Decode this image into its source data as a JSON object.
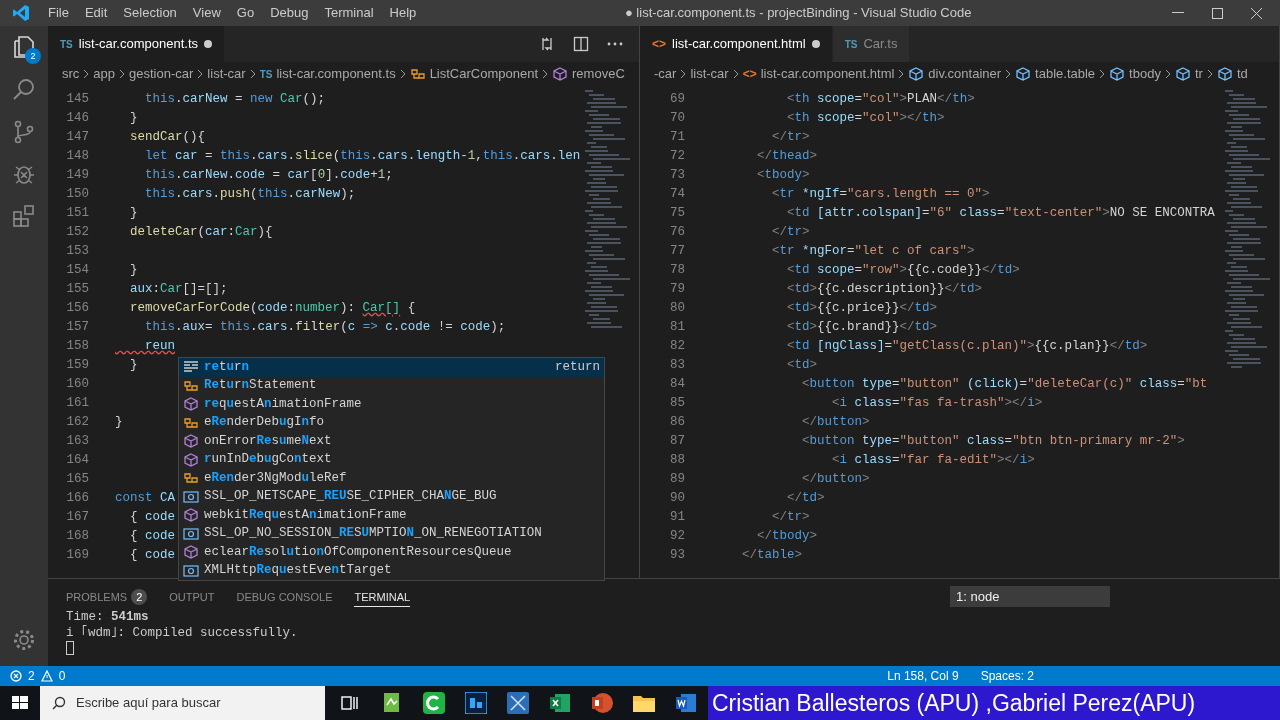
{
  "window": {
    "title": "● list-car.component.ts - projectBinding - Visual Studio Code"
  },
  "menu": [
    "File",
    "Edit",
    "Selection",
    "View",
    "Go",
    "Debug",
    "Terminal",
    "Help"
  ],
  "activity_bar": {
    "explorer_badge": "2"
  },
  "editor_groups": [
    {
      "tabs": [
        {
          "icon": "TS",
          "label": "list-car.component.ts",
          "selected": true,
          "modified": true
        }
      ],
      "breadcrumbs": [
        {
          "kind": "text",
          "label": "src"
        },
        {
          "kind": "text",
          "label": "app"
        },
        {
          "kind": "text",
          "label": "gestion-car"
        },
        {
          "kind": "text",
          "label": "list-car"
        },
        {
          "kind": "file",
          "icon": "TS",
          "label": "list-car.component.ts"
        },
        {
          "kind": "class",
          "label": "ListCarComponent"
        },
        {
          "kind": "method",
          "label": "removeC"
        }
      ],
      "lines": [
        {
          "number": "145",
          "segments": [
            {
              "text": "    this",
              "kind": "k"
            },
            {
              "text": ".",
              "kind": "p"
            },
            {
              "text": "carNew",
              "kind": "v"
            },
            {
              "text": " = ",
              "kind": "p"
            },
            {
              "text": "new",
              "kind": "k"
            },
            {
              "text": " Car",
              "kind": "t"
            },
            {
              "text": "();",
              "kind": "p"
            }
          ]
        },
        {
          "number": "146",
          "segments": [
            {
              "text": "  }",
              "kind": "p"
            }
          ]
        },
        {
          "number": "147",
          "segments": [
            {
              "text": "  sendCar",
              "kind": "f"
            },
            {
              "text": "(){",
              "kind": "p"
            }
          ]
        },
        {
          "number": "148",
          "segments": [
            {
              "text": "    let",
              "kind": "k"
            },
            {
              "text": " car",
              "kind": "v"
            },
            {
              "text": " = ",
              "kind": "p"
            },
            {
              "text": "this",
              "kind": "k"
            },
            {
              "text": ".",
              "kind": "p"
            },
            {
              "text": "cars",
              "kind": "v"
            },
            {
              "text": ".",
              "kind": "p"
            },
            {
              "text": "slice",
              "kind": "f"
            },
            {
              "text": "(",
              "kind": "p"
            },
            {
              "text": "this",
              "kind": "k"
            },
            {
              "text": ".",
              "kind": "p"
            },
            {
              "text": "cars",
              "kind": "v"
            },
            {
              "text": ".",
              "kind": "p"
            },
            {
              "text": "length",
              "kind": "v"
            },
            {
              "text": "-",
              "kind": "p"
            },
            {
              "text": "1",
              "kind": "n"
            },
            {
              "text": ",",
              "kind": "p"
            },
            {
              "text": "this",
              "kind": "k"
            },
            {
              "text": ".",
              "kind": "p"
            },
            {
              "text": "cars",
              "kind": "v"
            },
            {
              "text": ".",
              "kind": "p"
            },
            {
              "text": "len",
              "kind": "v"
            }
          ]
        },
        {
          "number": "149",
          "segments": [
            {
              "text": "    this",
              "kind": "k"
            },
            {
              "text": ".",
              "kind": "p"
            },
            {
              "text": "carNew",
              "kind": "v"
            },
            {
              "text": ".",
              "kind": "p"
            },
            {
              "text": "code",
              "kind": "v"
            },
            {
              "text": " = ",
              "kind": "p"
            },
            {
              "text": "car",
              "kind": "v"
            },
            {
              "text": "[",
              "kind": "p"
            },
            {
              "text": "0",
              "kind": "n"
            },
            {
              "text": "].",
              "kind": "p"
            },
            {
              "text": "code",
              "kind": "v"
            },
            {
              "text": "+",
              "kind": "p"
            },
            {
              "text": "1",
              "kind": "n"
            },
            {
              "text": ";",
              "kind": "p"
            }
          ]
        },
        {
          "number": "150",
          "segments": [
            {
              "text": "    this",
              "kind": "k"
            },
            {
              "text": ".",
              "kind": "p"
            },
            {
              "text": "cars",
              "kind": "v"
            },
            {
              "text": ".",
              "kind": "p"
            },
            {
              "text": "push",
              "kind": "f"
            },
            {
              "text": "(",
              "kind": "p"
            },
            {
              "text": "this",
              "kind": "k"
            },
            {
              "text": ".",
              "kind": "p"
            },
            {
              "text": "carNew",
              "kind": "v"
            },
            {
              "text": ");",
              "kind": "p"
            }
          ]
        },
        {
          "number": "151",
          "segments": [
            {
              "text": "  }",
              "kind": "p"
            }
          ]
        },
        {
          "number": "152",
          "segments": [
            {
              "text": "  deleteCar",
              "kind": "f"
            },
            {
              "text": "(",
              "kind": "p"
            },
            {
              "text": "car",
              "kind": "v"
            },
            {
              "text": ":",
              "kind": "p"
            },
            {
              "text": "Car",
              "kind": "t"
            },
            {
              "text": "){",
              "kind": "p"
            }
          ]
        },
        {
          "number": "153"
        },
        {
          "number": "154",
          "segments": [
            {
              "text": "  }",
              "kind": "p"
            }
          ]
        },
        {
          "number": "155",
          "segments": [
            {
              "text": "  aux",
              "kind": "v"
            },
            {
              "text": ":",
              "kind": "p"
            },
            {
              "text": "Car",
              "kind": "t"
            },
            {
              "text": "[]=[];",
              "kind": "p"
            }
          ]
        },
        {
          "number": "156",
          "segments": [
            {
              "text": "  removeCarForCode",
              "kind": "f"
            },
            {
              "text": "(",
              "kind": "p"
            },
            {
              "text": "code",
              "kind": "v"
            },
            {
              "text": ":",
              "kind": "p"
            },
            {
              "text": "number",
              "kind": "t"
            },
            {
              "text": "): ",
              "kind": "p"
            },
            {
              "text": "Car[]",
              "kind": "terr"
            },
            {
              "text": " {",
              "kind": "p"
            }
          ]
        },
        {
          "number": "157",
          "segments": [
            {
              "text": "    this",
              "kind": "k"
            },
            {
              "text": ".",
              "kind": "p"
            },
            {
              "text": "aux",
              "kind": "v"
            },
            {
              "text": "= ",
              "kind": "p"
            },
            {
              "text": "this",
              "kind": "k"
            },
            {
              "text": ".",
              "kind": "p"
            },
            {
              "text": "cars",
              "kind": "v"
            },
            {
              "text": ".",
              "kind": "p"
            },
            {
              "text": "filter",
              "kind": "f"
            },
            {
              "text": "(",
              "kind": "p"
            },
            {
              "text": "c",
              "kind": "v"
            },
            {
              "text": " =>",
              "kind": "k"
            },
            {
              "text": " c",
              "kind": "v"
            },
            {
              "text": ".",
              "kind": "p"
            },
            {
              "text": "code",
              "kind": "v"
            },
            {
              "text": " != ",
              "kind": "p"
            },
            {
              "text": "code",
              "kind": "v"
            },
            {
              "text": ");",
              "kind": "p"
            }
          ]
        },
        {
          "number": "158",
          "segments": [
            {
              "text": "    reun",
              "kind": "verr"
            }
          ]
        },
        {
          "number": "159",
          "segments": [
            {
              "text": "  }",
              "kind": "p"
            }
          ]
        },
        {
          "number": "160"
        },
        {
          "number": "161"
        },
        {
          "number": "162",
          "segments": [
            {
              "text": "}",
              "kind": "p"
            }
          ]
        },
        {
          "number": "163"
        },
        {
          "number": "164"
        },
        {
          "number": "165"
        },
        {
          "number": "166",
          "segments": [
            {
              "text": "const",
              "kind": "k"
            },
            {
              "text": " CA",
              "kind": "v"
            }
          ]
        },
        {
          "number": "167",
          "segments": [
            {
              "text": "  { ",
              "kind": "p"
            },
            {
              "text": "code",
              "kind": "v"
            }
          ]
        },
        {
          "number": "168",
          "segments": [
            {
              "text": "  { ",
              "kind": "p"
            },
            {
              "text": "code",
              "kind": "v"
            }
          ]
        },
        {
          "number": "169",
          "segments": [
            {
              "text": "  { ",
              "kind": "p"
            },
            {
              "text": "code",
              "kind": "v"
            }
          ]
        }
      ],
      "suggestions": [
        {
          "kind": "keyword",
          "label": "**re**t**u**r**n**",
          "detail": "return",
          "selected": true
        },
        {
          "kind": "interface",
          "label": "**Re**t**u**r**n**Statement",
          "selected": false
        },
        {
          "kind": "method",
          "label": "**re**q**u**estA**n**imationFrame",
          "selected": false
        },
        {
          "kind": "interface",
          "label": "e**Re**nderDeb**u**gI**n**fo",
          "selected": false
        },
        {
          "kind": "method",
          "label": "onError**Re**s**u**me**N**ext",
          "selected": false
        },
        {
          "kind": "method",
          "label": "**r**unInD**e**b**u**gCo**n**text",
          "selected": false
        },
        {
          "kind": "interface",
          "label": "e**Ren**der3NgMod**u**leRef",
          "selected": false
        },
        {
          "kind": "variable",
          "label": "SSL_OP_NETSCAPE_**REU**SE_CIPHER_CHA**N**GE_BUG",
          "selected": false
        },
        {
          "kind": "method",
          "label": "webkit**Re**q**u**estA**n**imationFrame",
          "selected": false
        },
        {
          "kind": "variable",
          "label": "SSL_OP_NO_SESSION_**RE**S**U**MPTIO**N**_ON_RENEGOTIATION",
          "selected": false
        },
        {
          "kind": "method",
          "label": "eclear**Re**sol**u**tio**n**OfComponentResourcesQueue",
          "selected": false
        },
        {
          "kind": "variable",
          "label": "XMLHttp**Re**q**u**estEve**n**tTarget",
          "selected": false
        }
      ]
    },
    {
      "tabs": [
        {
          "icon": "<>",
          "label": "list-car.component.html",
          "selected": true,
          "modified": true
        },
        {
          "icon": "TS",
          "label": "Car.ts",
          "selected": false,
          "modified": false
        }
      ],
      "breadcrumbs": [
        {
          "kind": "text",
          "label": "-car"
        },
        {
          "kind": "text",
          "label": "list-car"
        },
        {
          "kind": "file",
          "icon": "<>",
          "label": "list-car.component.html"
        },
        {
          "kind": "element",
          "label": "div.container"
        },
        {
          "kind": "element",
          "label": "table.table"
        },
        {
          "kind": "element",
          "label": "tbody"
        },
        {
          "kind": "element",
          "label": "tr"
        },
        {
          "kind": "element",
          "label": "td"
        }
      ],
      "lines": [
        {
          "number": "69",
          "segments": [
            {
              "text": "          <",
              "kind": "g"
            },
            {
              "text": "th",
              "kind": "k"
            },
            {
              "text": " scope",
              "kind": "v"
            },
            {
              "text": "=",
              "kind": "p"
            },
            {
              "text": "\"col\"",
              "kind": "s"
            },
            {
              "text": ">",
              "kind": "g"
            },
            {
              "text": "PLAN",
              "kind": "p"
            },
            {
              "text": "</",
              "kind": "g"
            },
            {
              "text": "th",
              "kind": "k"
            },
            {
              "text": ">",
              "kind": "g"
            }
          ]
        },
        {
          "number": "70",
          "segments": [
            {
              "text": "          <",
              "kind": "g"
            },
            {
              "text": "th",
              "kind": "k"
            },
            {
              "text": " scope",
              "kind": "v"
            },
            {
              "text": "=",
              "kind": "p"
            },
            {
              "text": "\"col\"",
              "kind": "s"
            },
            {
              "text": "></",
              "kind": "g"
            },
            {
              "text": "th",
              "kind": "k"
            },
            {
              "text": ">",
              "kind": "g"
            }
          ]
        },
        {
          "number": "71",
          "segments": [
            {
              "text": "        </",
              "kind": "g"
            },
            {
              "text": "tr",
              "kind": "k"
            },
            {
              "text": ">",
              "kind": "g"
            }
          ]
        },
        {
          "number": "72",
          "segments": [
            {
              "text": "      </",
              "kind": "g"
            },
            {
              "text": "thead",
              "kind": "k"
            },
            {
              "text": ">",
              "kind": "g"
            }
          ]
        },
        {
          "number": "73",
          "segments": [
            {
              "text": "      <",
              "kind": "g"
            },
            {
              "text": "tbody",
              "kind": "k"
            },
            {
              "text": ">",
              "kind": "g"
            }
          ]
        },
        {
          "number": "74",
          "segments": [
            {
              "text": "        <",
              "kind": "g"
            },
            {
              "text": "tr",
              "kind": "k"
            },
            {
              "text": " *ngIf",
              "kind": "v"
            },
            {
              "text": "=",
              "kind": "p"
            },
            {
              "text": "\"cars.length == 0\"",
              "kind": "s"
            },
            {
              "text": ">",
              "kind": "g"
            }
          ]
        },
        {
          "number": "75",
          "segments": [
            {
              "text": "          <",
              "kind": "g"
            },
            {
              "text": "td",
              "kind": "k"
            },
            {
              "text": " [attr.colspan]",
              "kind": "v"
            },
            {
              "text": "=",
              "kind": "p"
            },
            {
              "text": "\"6\"",
              "kind": "s"
            },
            {
              "text": " class",
              "kind": "v"
            },
            {
              "text": "=",
              "kind": "p"
            },
            {
              "text": "\"text-center\"",
              "kind": "s"
            },
            {
              "text": ">",
              "kind": "g"
            },
            {
              "text": "NO SE ENCONTRA",
              "kind": "p"
            }
          ]
        },
        {
          "number": "76",
          "segments": [
            {
              "text": "        </",
              "kind": "g"
            },
            {
              "text": "tr",
              "kind": "k"
            },
            {
              "text": ">",
              "kind": "g"
            }
          ]
        },
        {
          "number": "77",
          "segments": [
            {
              "text": "        <",
              "kind": "g"
            },
            {
              "text": "tr",
              "kind": "k"
            },
            {
              "text": " *ngFor",
              "kind": "v"
            },
            {
              "text": "=",
              "kind": "p"
            },
            {
              "text": "\"let c of cars\"",
              "kind": "s"
            },
            {
              "text": ">",
              "kind": "g"
            }
          ]
        },
        {
          "number": "78",
          "segments": [
            {
              "text": "          <",
              "kind": "g"
            },
            {
              "text": "td",
              "kind": "k"
            },
            {
              "text": " scope",
              "kind": "v"
            },
            {
              "text": "=",
              "kind": "p"
            },
            {
              "text": "\"row\"",
              "kind": "s"
            },
            {
              "text": ">",
              "kind": "g"
            },
            {
              "text": "{{c.code}}",
              "kind": "p"
            },
            {
              "text": "</",
              "kind": "g"
            },
            {
              "text": "td",
              "kind": "k"
            },
            {
              "text": ">",
              "kind": "g"
            }
          ]
        },
        {
          "number": "79",
          "segments": [
            {
              "text": "          <",
              "kind": "g"
            },
            {
              "text": "td",
              "kind": "k"
            },
            {
              "text": ">",
              "kind": "g"
            },
            {
              "text": "{{c.description}}",
              "kind": "p"
            },
            {
              "text": "</",
              "kind": "g"
            },
            {
              "text": "td",
              "kind": "k"
            },
            {
              "text": ">",
              "kind": "g"
            }
          ]
        },
        {
          "number": "80",
          "segments": [
            {
              "text": "          <",
              "kind": "g"
            },
            {
              "text": "td",
              "kind": "k"
            },
            {
              "text": ">",
              "kind": "g"
            },
            {
              "text": "{{c.price}}",
              "kind": "p"
            },
            {
              "text": "</",
              "kind": "g"
            },
            {
              "text": "td",
              "kind": "k"
            },
            {
              "text": ">",
              "kind": "g"
            }
          ]
        },
        {
          "number": "81",
          "segments": [
            {
              "text": "          <",
              "kind": "g"
            },
            {
              "text": "td",
              "kind": "k"
            },
            {
              "text": ">",
              "kind": "g"
            },
            {
              "text": "{{c.brand}}",
              "kind": "p"
            },
            {
              "text": "</",
              "kind": "g"
            },
            {
              "text": "td",
              "kind": "k"
            },
            {
              "text": ">",
              "kind": "g"
            }
          ]
        },
        {
          "number": "82",
          "segments": [
            {
              "text": "          <",
              "kind": "g"
            },
            {
              "text": "td",
              "kind": "k"
            },
            {
              "text": " [ngClass]",
              "kind": "v"
            },
            {
              "text": "=",
              "kind": "p"
            },
            {
              "text": "\"getClass(c.plan)\"",
              "kind": "s"
            },
            {
              "text": ">",
              "kind": "g"
            },
            {
              "text": "{{c.plan}}",
              "kind": "p"
            },
            {
              "text": "</",
              "kind": "g"
            },
            {
              "text": "td",
              "kind": "k"
            },
            {
              "text": ">",
              "kind": "g"
            }
          ]
        },
        {
          "number": "83",
          "segments": [
            {
              "text": "          <",
              "kind": "g"
            },
            {
              "text": "td",
              "kind": "k"
            },
            {
              "text": ">",
              "kind": "g"
            }
          ]
        },
        {
          "number": "84",
          "segments": [
            {
              "text": "            <",
              "kind": "g"
            },
            {
              "text": "button",
              "kind": "k"
            },
            {
              "text": " type",
              "kind": "v"
            },
            {
              "text": "=",
              "kind": "p"
            },
            {
              "text": "\"button\"",
              "kind": "s"
            },
            {
              "text": " (click)",
              "kind": "v"
            },
            {
              "text": "=",
              "kind": "p"
            },
            {
              "text": "\"deleteCar(c)\"",
              "kind": "s"
            },
            {
              "text": " class",
              "kind": "v"
            },
            {
              "text": "=",
              "kind": "p"
            },
            {
              "text": "\"bt",
              "kind": "s"
            }
          ]
        },
        {
          "number": "85",
          "segments": [
            {
              "text": "                <",
              "kind": "g"
            },
            {
              "text": "i",
              "kind": "k"
            },
            {
              "text": " class",
              "kind": "v"
            },
            {
              "text": "=",
              "kind": "p"
            },
            {
              "text": "\"fas fa-trash\"",
              "kind": "s"
            },
            {
              "text": "></",
              "kind": "g"
            },
            {
              "text": "i",
              "kind": "k"
            },
            {
              "text": ">",
              "kind": "g"
            }
          ]
        },
        {
          "number": "86",
          "segments": [
            {
              "text": "            </",
              "kind": "g"
            },
            {
              "text": "button",
              "kind": "k"
            },
            {
              "text": ">",
              "kind": "g"
            }
          ]
        },
        {
          "number": "87",
          "segments": [
            {
              "text": "            <",
              "kind": "g"
            },
            {
              "text": "button",
              "kind": "k"
            },
            {
              "text": " type",
              "kind": "v"
            },
            {
              "text": "=",
              "kind": "p"
            },
            {
              "text": "\"button\"",
              "kind": "s"
            },
            {
              "text": " class",
              "kind": "v"
            },
            {
              "text": "=",
              "kind": "p"
            },
            {
              "text": "\"btn btn-primary mr-2\"",
              "kind": "s"
            },
            {
              "text": ">",
              "kind": "g"
            }
          ]
        },
        {
          "number": "88",
          "segments": [
            {
              "text": "                <",
              "kind": "g"
            },
            {
              "text": "i",
              "kind": "k"
            },
            {
              "text": " class",
              "kind": "v"
            },
            {
              "text": "=",
              "kind": "p"
            },
            {
              "text": "\"far fa-edit\"",
              "kind": "s"
            },
            {
              "text": "></",
              "kind": "g"
            },
            {
              "text": "i",
              "kind": "k"
            },
            {
              "text": ">",
              "kind": "g"
            }
          ]
        },
        {
          "number": "89",
          "segments": [
            {
              "text": "            </",
              "kind": "g"
            },
            {
              "text": "button",
              "kind": "k"
            },
            {
              "text": ">",
              "kind": "g"
            }
          ]
        },
        {
          "number": "90",
          "segments": [
            {
              "text": "          </",
              "kind": "g"
            },
            {
              "text": "td",
              "kind": "k"
            },
            {
              "text": ">",
              "kind": "g"
            }
          ]
        },
        {
          "number": "91",
          "segments": [
            {
              "text": "        </",
              "kind": "g"
            },
            {
              "text": "tr",
              "kind": "k"
            },
            {
              "text": ">",
              "kind": "g"
            }
          ]
        },
        {
          "number": "92",
          "segments": [
            {
              "text": "      </",
              "kind": "g"
            },
            {
              "text": "tbody",
              "kind": "k"
            },
            {
              "text": ">",
              "kind": "g"
            }
          ]
        },
        {
          "number": "93",
          "segments": [
            {
              "text": "    </",
              "kind": "g"
            },
            {
              "text": "table",
              "kind": "k"
            },
            {
              "text": ">",
              "kind": "g"
            }
          ]
        }
      ]
    }
  ],
  "panel": {
    "tabs": [
      {
        "label": "PROBLEMS",
        "badge": "2",
        "selected": false
      },
      {
        "label": "OUTPUT",
        "selected": false
      },
      {
        "label": "DEBUG CONSOLE",
        "selected": false
      },
      {
        "label": "TERMINAL",
        "selected": true
      }
    ],
    "terminal_select": "1: node",
    "terminal_lines": [
      "Time: **541ms**",
      "i ｢wdm｣: Compiled successfully."
    ]
  },
  "status_bar": {
    "errors": "2",
    "warnings": "0",
    "position": "Ln 158, Col 9",
    "indent": "Spaces: 2"
  },
  "taskbar": {
    "search_placeholder": "Escribe aquí para buscar"
  },
  "caption": "Cristian Ballesteros (APU) ,Gabriel Perez(APU)"
}
